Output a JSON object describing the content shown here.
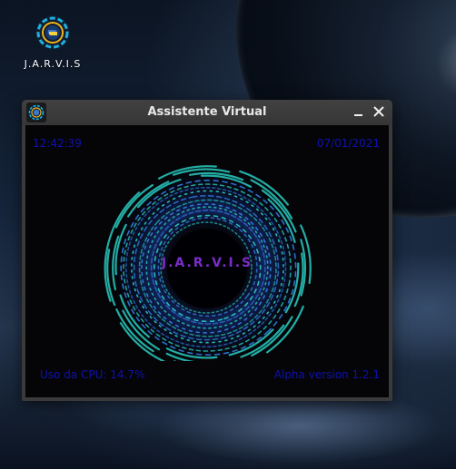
{
  "desktop": {
    "icon_label": "J.A.R.V.I.S",
    "icon": "jarvis-app-icon"
  },
  "window": {
    "title": "Assistente Virtual",
    "minimize_icon": "minimize-icon",
    "close_icon": "close-icon",
    "clock": "12:42:39",
    "date": "07/01/2021",
    "core_label": "J.A.R.V.I.S",
    "cpu_text": "Uso da CPU: 14.7%",
    "version_text": "Alpha version 1.2.1"
  },
  "colors": {
    "corner_text": "#1010b0",
    "core_label": "#7a2cc8",
    "ring_cyan": "#2ee6d8",
    "ring_blue": "#3a8bff"
  }
}
